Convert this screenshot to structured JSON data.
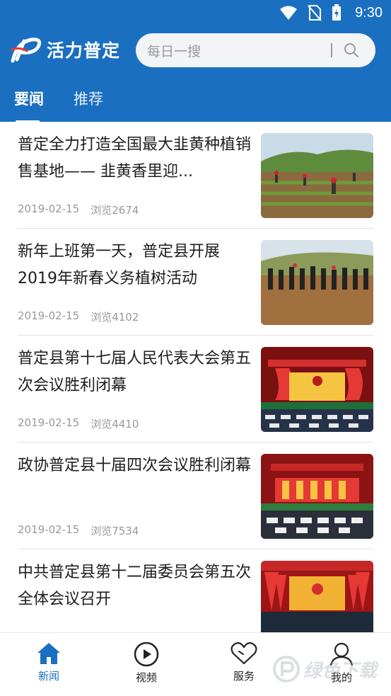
{
  "status_bar": {
    "time": "9:30"
  },
  "header": {
    "brand_name": "活力普定"
  },
  "search": {
    "placeholder": "每日一搜"
  },
  "tabs": [
    {
      "label": "要闻",
      "active": true
    },
    {
      "label": "推荐",
      "active": false
    }
  ],
  "news": [
    {
      "title": "普定全力打造全国最大韭黄种植销售基地—— 韭黄香里迎...",
      "date": "2019-02-15",
      "views": "浏览2674",
      "thumb": "farm-field"
    },
    {
      "title": "新年上班第一天，普定县开展2019年新春义务植树活动",
      "date": "2019-02-15",
      "views": "浏览4102",
      "thumb": "tree-planting"
    },
    {
      "title": "普定县第十七届人民代表大会第五次会议胜利闭幕",
      "date": "2019-02-15",
      "views": "浏览4410",
      "thumb": "conference-hall"
    },
    {
      "title": "政协普定县十届四次会议胜利闭幕",
      "date": "2019-02-15",
      "views": "浏览7534",
      "thumb": "conference-hall"
    },
    {
      "title": "中共普定县第十二届委员会第五次全体会议召开",
      "date": "",
      "views": "",
      "thumb": "conference-flags"
    }
  ],
  "bottom_nav": [
    {
      "label": "新闻",
      "icon": "home-icon",
      "active": true
    },
    {
      "label": "视频",
      "icon": "play-icon",
      "active": false
    },
    {
      "label": "服务",
      "icon": "heart-icon",
      "active": false
    },
    {
      "label": "我的",
      "icon": "user-icon",
      "active": false
    }
  ],
  "watermark": {
    "text": "绿色下载"
  },
  "colors": {
    "primary": "#1b6fc0",
    "text": "#1e1e1e",
    "meta": "#999999"
  }
}
